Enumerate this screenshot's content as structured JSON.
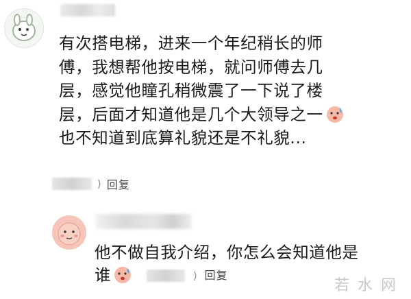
{
  "main_comment": {
    "lines": [
      "有次搭电梯，进来一个年纪稍长的师",
      "傅，我想帮他按电梯，就问师傅去几",
      "层，感觉他瞳孔稍微震了一下说了楼",
      "层，后面才知道他是几个大领导之一",
      "也不知道到底算礼貌还是不礼貌..."
    ],
    "emoji": "crying-face-emoji",
    "reply_label": "回复"
  },
  "reply_comment": {
    "lines": [
      "他不做自我介绍，你怎么会知道他是",
      "谁"
    ],
    "emoji": "crying-face-emoji",
    "reply_label": "回复"
  },
  "watermark": "若水网",
  "colors": {
    "text": "#1a1a1a",
    "meta": "#555555",
    "watermark": "#c9c9c9"
  }
}
